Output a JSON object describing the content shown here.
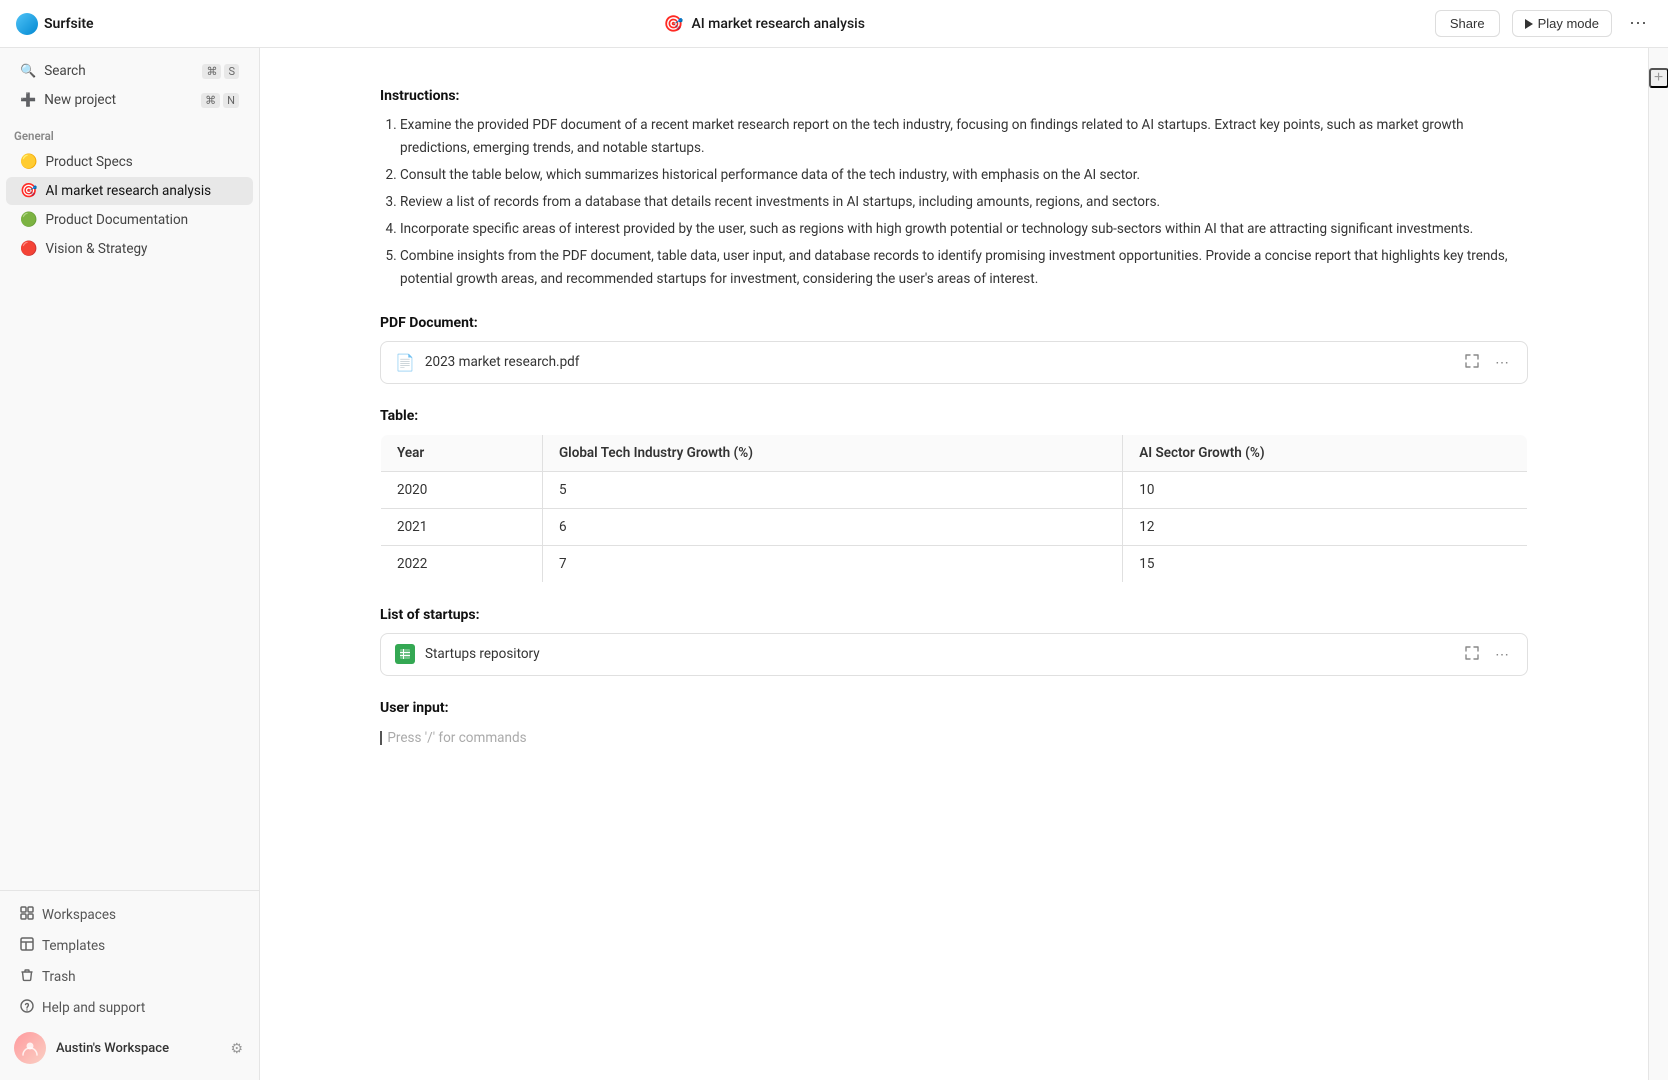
{
  "app": {
    "name": "Surfsite",
    "logo_emoji": "🌊"
  },
  "topbar": {
    "share_label": "Share",
    "play_mode_label": "Play mode",
    "page_title": "AI market research analysis",
    "page_emoji": "🎯"
  },
  "sidebar": {
    "search_label": "Search",
    "search_shortcut_meta": "⌘",
    "search_shortcut_key": "S",
    "new_project_label": "New project",
    "new_project_shortcut_meta": "⌘",
    "new_project_shortcut_key": "N",
    "section_general": "General",
    "items": [
      {
        "id": "product-specs",
        "label": "Product Specs",
        "emoji": "🟡",
        "active": false
      },
      {
        "id": "ai-market",
        "label": "AI market research analysis",
        "emoji": "🎯",
        "active": true
      },
      {
        "id": "product-docs",
        "label": "Product Documentation",
        "emoji": "🟢",
        "active": false
      },
      {
        "id": "vision-strategy",
        "label": "Vision & Strategy",
        "emoji": "🔴",
        "active": false
      }
    ],
    "bottom_items": [
      {
        "id": "workspaces",
        "label": "Workspaces",
        "icon": "grid"
      },
      {
        "id": "templates",
        "label": "Templates",
        "icon": "template"
      },
      {
        "id": "trash",
        "label": "Trash",
        "icon": "trash"
      },
      {
        "id": "help",
        "label": "Help and support",
        "icon": "help"
      }
    ],
    "workspace": {
      "name": "Austin's Workspace",
      "avatar_emoji": "👤"
    }
  },
  "content": {
    "instructions_label": "Instructions:",
    "instructions": [
      "Examine the provided PDF document of a recent market research report on the tech industry, focusing on findings related to AI startups. Extract key points, such as market growth predictions, emerging trends, and notable startups.",
      "Consult the table below, which summarizes historical performance data of the tech industry, with emphasis on the AI sector.",
      "Review a list of records from a database that details recent investments in AI startups, including amounts, regions, and sectors.",
      "Incorporate specific areas of interest provided by the user, such as regions with high growth potential or technology sub-sectors within AI that are attracting significant investments.",
      "Combine insights from the PDF document, table data, user input, and database records to identify promising investment opportunities. Provide a concise report that highlights key trends, potential growth areas, and recommended startups for investment, considering the user's areas of interest."
    ],
    "pdf_section_label": "PDF Document:",
    "pdf_filename": "2023 market research.pdf",
    "table_section_label": "Table:",
    "table_headers": [
      "Year",
      "Global Tech Industry Growth (%)",
      "AI Sector Growth (%)"
    ],
    "table_rows": [
      [
        "2020",
        "5",
        "10"
      ],
      [
        "2021",
        "6",
        "12"
      ],
      [
        "2022",
        "7",
        "15"
      ]
    ],
    "startups_label": "List of startups:",
    "startups_filename": "Startups repository",
    "user_input_label": "User input:",
    "user_input_placeholder": "Press '/' for commands"
  }
}
